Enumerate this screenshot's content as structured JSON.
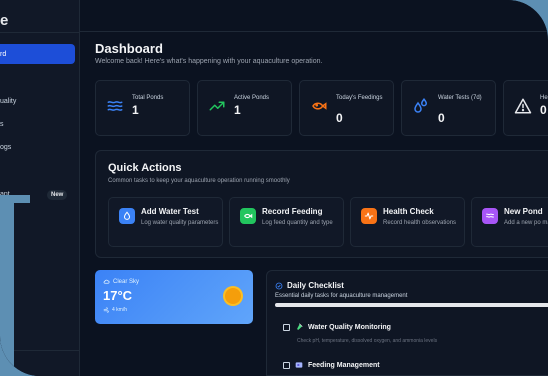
{
  "sidebar": {
    "brand": "e",
    "items": [
      {
        "label": "rd",
        "active": true
      },
      {
        "label": "uality"
      },
      {
        "label": "s"
      },
      {
        "label": "ogs"
      },
      {
        "label": "ant"
      },
      {
        "label": "pee"
      }
    ],
    "badge": "New",
    "bottom_text": "y"
  },
  "header": {
    "title": "Dashboard",
    "subtitle": "Welcome back! Here's what's happening with your aquaculture operation."
  },
  "stats": [
    {
      "label": "Total Ponds",
      "value": "1",
      "icon": "waves-icon",
      "color": "#3b82f6"
    },
    {
      "label": "Active Ponds",
      "value": "1",
      "icon": "trending-up-icon",
      "color": "#22c55e"
    },
    {
      "label": "Today's Feedings",
      "value": "0",
      "icon": "fish-icon",
      "color": "#f97316"
    },
    {
      "label": "Water Tests (7d)",
      "value": "0",
      "icon": "droplets-icon",
      "color": "#3b82f6"
    },
    {
      "label": "He",
      "value": "0",
      "icon": "alert-triangle-icon",
      "color": "#e5e7eb"
    }
  ],
  "quick_actions": {
    "title": "Quick Actions",
    "subtitle": "Common tasks to keep your aquaculture operation running smoothly",
    "items": [
      {
        "title": "Add Water Test",
        "desc": "Log water quality parameters",
        "icon": "droplet-icon",
        "color": "#3b82f6"
      },
      {
        "title": "Record Feeding",
        "desc": "Log feed quantity and type",
        "icon": "fish-icon",
        "color": "#22c55e"
      },
      {
        "title": "Health Check",
        "desc": "Record health observations",
        "icon": "activity-icon",
        "color": "#f97316"
      },
      {
        "title": "New Pond",
        "desc": "Add a new po manage",
        "icon": "waves-icon",
        "color": "#a855f7"
      }
    ]
  },
  "weather": {
    "condition": "Clear Sky",
    "temperature": "17°C",
    "wind": "4 km/h"
  },
  "checklist": {
    "title": "Daily Checklist",
    "subtitle": "Essential daily tasks for aquaculture management",
    "items": [
      {
        "label": "Water Quality Monitoring",
        "desc": "Check pH, temperature, dissolved oxygen, and ammonia levels"
      },
      {
        "label": "Feeding Management",
        "desc": ""
      }
    ]
  }
}
